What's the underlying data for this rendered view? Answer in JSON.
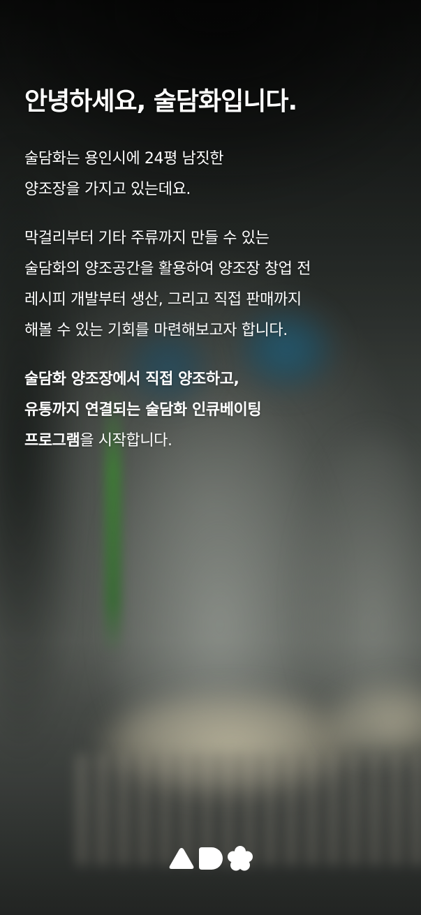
{
  "intro": {
    "title": "안녕하세요, 술담화입니다.",
    "paragraph1": [
      "술담화는 용인시에 24평 남짓한",
      "양조장을 가지고 있는데요."
    ],
    "paragraph2": [
      "막걸리부터 기타 주류까지 만들 수 있는",
      "술담화의 양조공간을 활용하여 양조장 창업 전",
      "레시피 개발부터 생산, 그리고 직접 판매까지",
      "해볼 수 있는 기회를 마련해보고자 합니다."
    ],
    "paragraph3": {
      "line1": "술담화 양조장에서 직접 양조하고,",
      "line2": "유통까지 연결되는 술담화 인큐베이팅",
      "line3_bold": "프로그램",
      "line3_rest": "을 시작합니다."
    }
  },
  "logo": {
    "icons": [
      "triangle-icon",
      "speech-bubble-icon",
      "flower-icon"
    ],
    "color": "#ffffff"
  },
  "background": {
    "description_colors": [
      "#0b0c0b",
      "#575b56",
      "#2a2d2b"
    ],
    "accent_blue": "#286e8c",
    "accent_green": "#468c3c"
  }
}
